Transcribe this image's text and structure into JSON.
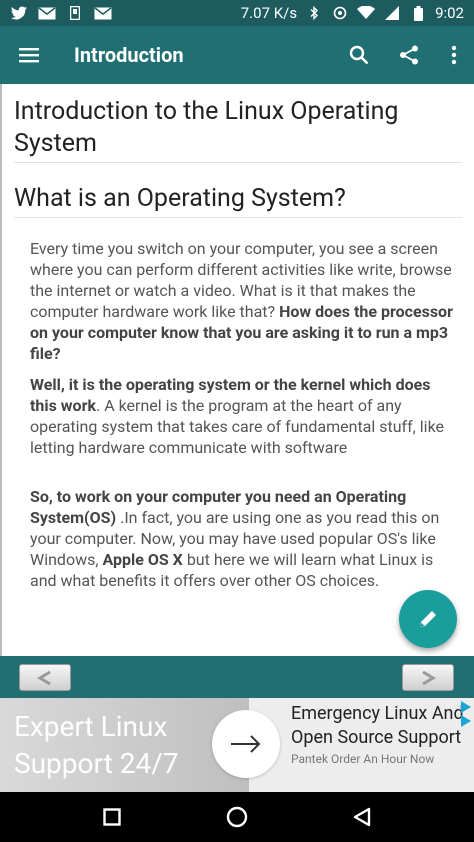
{
  "status_bar": {
    "network_speed": "7.07 K/s",
    "time": "9:02"
  },
  "toolbar": {
    "title": "Introduction"
  },
  "content": {
    "heading1": "Introduction to the Linux Operating System",
    "heading2": "What is an Operating System?",
    "p1_plain": "Every time you switch on your computer, you see a screen where you can perform different activities like write, browse the internet or watch a video. What is it that makes the computer hardware work like that? ",
    "p1_bold": "How does the processor on your computer know that you are asking it to run a mp3 file?",
    "p2_bold": "Well, it is the operating system or the kernel which does this work",
    "p2_plain": ". A kernel is the program at the heart of any operating system that takes care of fundamental stuff, like letting hardware communicate with software",
    "p3_bold1": "So, to work on your computer you need an Operating System(OS)",
    "p3_plain1": " .In fact,  you are using one as you read this on your computer. Now, you may have used popular OS's like Windows, ",
    "p3_bold2": "Apple OS X",
    "p3_plain2": " but here we will learn what Linux is and what benefits it offers over other OS choices."
  },
  "ad": {
    "headline": "Expert Linux Support 24/7",
    "title": "Emergency Linux And Open Source Support",
    "subtitle": "Pantek Order An Hour Now"
  },
  "colors": {
    "app_bar": "#1f6f73",
    "status_bar": "#1d5b5e",
    "fab": "#1a9e9b"
  }
}
